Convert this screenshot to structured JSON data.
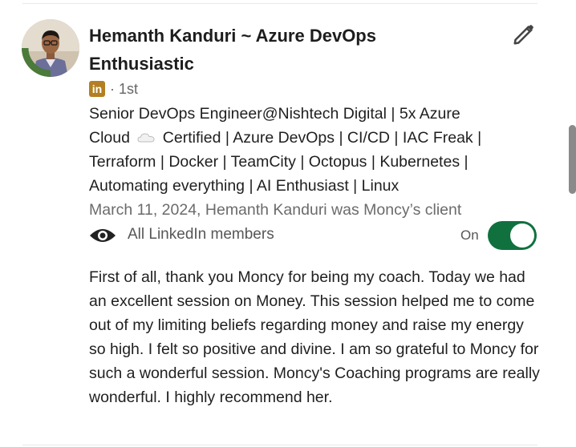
{
  "recommender": {
    "name": "Hemanth Kanduri ~ Azure DevOps Enthusiastic",
    "avatar_badge": "#OPENTOWORK",
    "network_icon": "linkedin-icon",
    "connection_degree": "· 1st",
    "headline_part1": "Senior DevOps Engineer@Nishtech Digital | 5x Azure Cloud",
    "headline_part2": "Certified | Azure DevOps | CI/CD | IAC Freak | Terraform | Docker | TeamCity | Octopus | Kubernetes | Automating everything | AI Enthusiast | Linux",
    "relationship": "March 11, 2024, Hemanth Kanduri was Moncy’s client"
  },
  "visibility": {
    "icon": "eye-icon",
    "label": "All LinkedIn members",
    "toggle_state": "On",
    "toggle_on": true,
    "toggle_color": "#10713f"
  },
  "recommendation": {
    "text": "First of all, thank you Moncy for being my coach. Today we had an excellent session on Money. This session helped me to come out of my limiting beliefs regarding money and raise my energy so high. I felt so positive and divine. I am so grateful to Moncy for such a wonderful session. Moncy's Coaching programs are really wonderful. I highly recommend her."
  },
  "actions": {
    "edit_icon": "pencil-icon"
  },
  "colors": {
    "linkedin_badge": "#b37f22",
    "opentowork_ring": "#4b7a3a"
  }
}
